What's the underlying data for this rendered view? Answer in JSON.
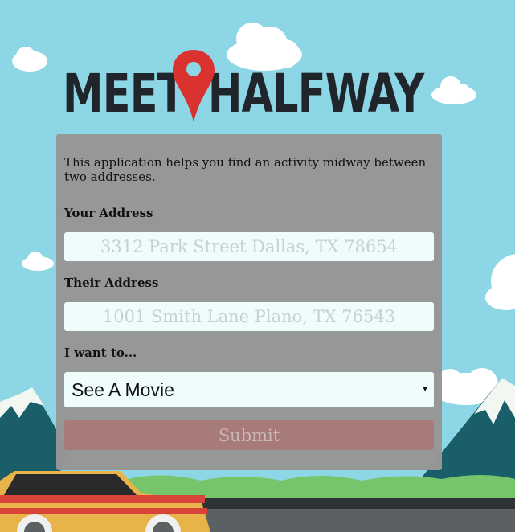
{
  "brand": {
    "word1": "MEET",
    "word2": "HALFWAY"
  },
  "intro_text": "This application helps you find an activity midway between two addresses.",
  "form": {
    "your_address_label": "Your Address",
    "your_address_placeholder": "3312 Park Street Dallas, TX 78654",
    "their_address_label": "Their Address",
    "their_address_placeholder": "1001 Smith Lane Plano, TX 76543",
    "activity_label": "I want to...",
    "activity_selected": "See A Movie",
    "submit_label": "Submit"
  },
  "colors": {
    "sky": "#8dd6e6",
    "logo": "#1f252b",
    "pin": "#d9322f",
    "submit": "#a87a79",
    "field": "#eefdfb"
  },
  "icons": {
    "pin": "map-pin-icon",
    "caret": "caret-down-icon"
  }
}
